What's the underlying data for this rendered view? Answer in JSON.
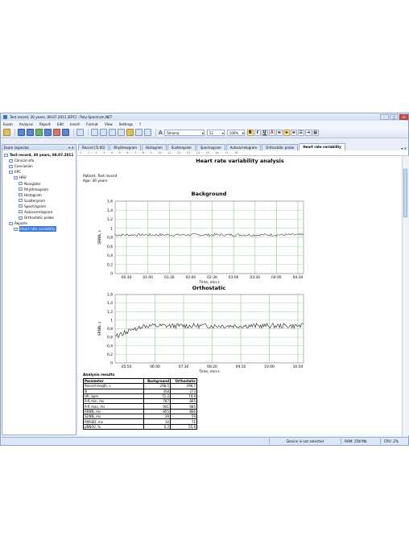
{
  "window": {
    "title": "Test record, 30 years, 09.07.2011 [EPC] - Poly-Spectrum.NET"
  },
  "menu": [
    "Exam",
    "Analysis",
    "Report",
    "Edit",
    "Insert",
    "Format",
    "View",
    "Settings",
    "?"
  ],
  "toolbar": {
    "font_name": "Tahoma",
    "font_size": "12",
    "zoom": "100%"
  },
  "sidebar": {
    "title": "Exam inspector",
    "items": [
      {
        "label": "Test record, 30 years, 09.07.2011",
        "depth": 0,
        "bold": true
      },
      {
        "label": "Clinical info",
        "depth": 1
      },
      {
        "label": "Conclusion",
        "depth": 1
      },
      {
        "label": "EPC",
        "depth": 1
      },
      {
        "label": "HRV",
        "depth": 2
      },
      {
        "label": "Navigator",
        "depth": 3
      },
      {
        "label": "Rhythmogram",
        "depth": 3
      },
      {
        "label": "Histogram",
        "depth": 3
      },
      {
        "label": "Scattergram",
        "depth": 3
      },
      {
        "label": "Spectrogram",
        "depth": 3
      },
      {
        "label": "Autocorrelogram",
        "depth": 3
      },
      {
        "label": "Orthostatic probe",
        "depth": 3
      },
      {
        "label": "Reports",
        "depth": 1
      },
      {
        "label": "Heart rate variability",
        "depth": 2,
        "selected": true
      }
    ]
  },
  "tabs": [
    {
      "label": "Record [I1:00]"
    },
    {
      "label": "Rhythmogram"
    },
    {
      "label": "Histogram"
    },
    {
      "label": "Scattergram"
    },
    {
      "label": "Spectrogram"
    },
    {
      "label": "Autocorrelogram"
    },
    {
      "label": "Orthostatic probe"
    },
    {
      "label": "Heart rate variability",
      "active": true
    }
  ],
  "ruler": "· 1 · · · 1 · · · 2 · · · 3 · · · 4 · · · 5 · · · 6 · · · 7 · · · 8 · · · 9 · · · 10 · · · 11 · · · 12 · · · 13 · · · 14 · · · 15 · · · 16 · · · 17 · · · 18 · ·",
  "report": {
    "title": "Heart rate variability analysis",
    "patient": "Patient: Test record",
    "age": "Age: 30 years",
    "results_title": "Analysis results",
    "table_header": [
      "Parameter",
      "Background",
      "Orthostatic"
    ],
    "rows": [
      [
        "Record length, s",
        "298,5",
        "298,7"
      ],
      [
        "N",
        "358",
        "373"
      ],
      [
        "HR, bpm",
        "72,2",
        "74,9"
      ],
      [
        "R-R min, ms",
        "787",
        "665"
      ],
      [
        "R-R max, ms",
        "941",
        "985"
      ],
      [
        "RRNN, ms",
        "855",
        "866"
      ],
      [
        "SDNN, ms",
        "29",
        "59"
      ],
      [
        "RMSSD, ms",
        "16",
        "71"
      ],
      [
        "pNN50, %",
        "0,3",
        "55,9"
      ]
    ]
  },
  "chart_data": [
    {
      "type": "line",
      "title": "Background",
      "xlabel": "Time, min:s",
      "ylabel": "SRNN, s",
      "ylim": [
        0,
        1.6
      ],
      "yticks": [
        "0",
        "0,2",
        "0,4",
        "0,6",
        "0,8",
        "1",
        "1,2",
        "1,4",
        "1,6"
      ],
      "xticks": [
        "00:30",
        "01:00",
        "01:30",
        "02:00",
        "02:30",
        "03:00",
        "03:30",
        "04:00",
        "04:30"
      ],
      "xlim_seconds": [
        10,
        300
      ],
      "series": [
        {
          "mean": 0.855,
          "sd": 0.029,
          "seed": 7
        }
      ],
      "line_color": "#404040",
      "grid_color": "#a8d8a8"
    },
    {
      "type": "line",
      "title": "Orthostatic",
      "xlabel": "Time, min:s",
      "ylabel": "SRNN, s",
      "ylim": [
        0,
        1.6
      ],
      "yticks": [
        "0",
        "0,2",
        "0,4",
        "0,6",
        "0,8",
        "1",
        "1,2",
        "1,4",
        "1,6"
      ],
      "xticks": [
        "05:50",
        "06:40",
        "07:30",
        "08:20",
        "09:10",
        "10:00",
        "10:50"
      ],
      "xlim_seconds": [
        310,
        655
      ],
      "series": [
        {
          "mean": 0.866,
          "sd": 0.059,
          "seed": 13
        }
      ],
      "line_color": "#202020",
      "grid_color": "#a8d8a8"
    }
  ],
  "statusbar": {
    "device": "Device is not selected",
    "ram": "RAM: 258 Mb",
    "cpu": "CPU: 2%"
  }
}
